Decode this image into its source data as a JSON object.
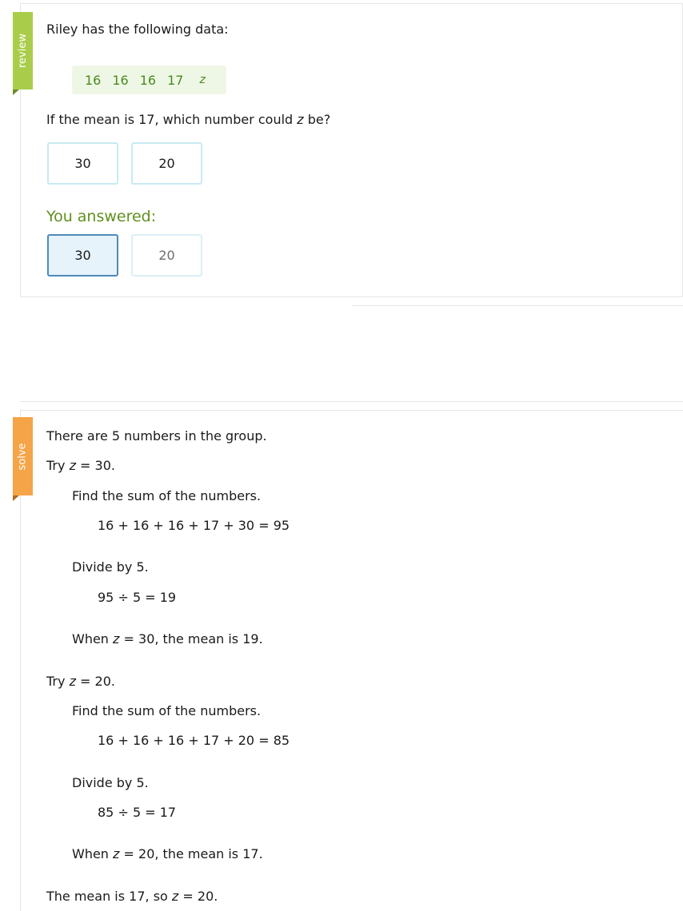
{
  "review": {
    "tab_label": "review",
    "question_intro": "Riley has the following data:",
    "data_values": [
      "16",
      "16",
      "16",
      "17",
      "z"
    ],
    "question_pre": "If the mean is 17, which number could ",
    "question_var": "z",
    "question_post": " be?",
    "choices": [
      "30",
      "20"
    ],
    "answered_label": "You answered:",
    "answered_choices": [
      "30",
      "20"
    ],
    "selected_answer": "30"
  },
  "solve": {
    "tab_label": "solve",
    "intro": "There are 5 numbers in the group.",
    "var": "z",
    "try1_pre": "Try ",
    "try1_post": " = 30.",
    "sum_label_1": "Find the sum of the numbers.",
    "sum_eq_1": "16 + 16 + 16 + 17 + 30 = 95",
    "divide_label_1": "Divide by 5.",
    "divide_eq_1": "95 ÷ 5 = 19",
    "when1_pre": "When ",
    "when1_post": " = 30, the mean is 19.",
    "try2_pre": "Try ",
    "try2_post": " = 20.",
    "sum_label_2": "Find the sum of the numbers.",
    "sum_eq_2": "16 + 16 + 16 + 17 + 20 = 85",
    "divide_label_2": "Divide by 5.",
    "divide_eq_2": "85 ÷ 5 = 17",
    "when2_pre": "When ",
    "when2_post": " = 20, the mean is 17.",
    "conclusion_pre": "The mean is 17, so ",
    "conclusion_post": " = 20."
  },
  "colors": {
    "review_tab": "#a9cd4b",
    "solve_tab": "#f5a447",
    "answered_text": "#5f8f1d",
    "data_text": "#4b8a1e",
    "selected_border": "#4e8ab8"
  }
}
